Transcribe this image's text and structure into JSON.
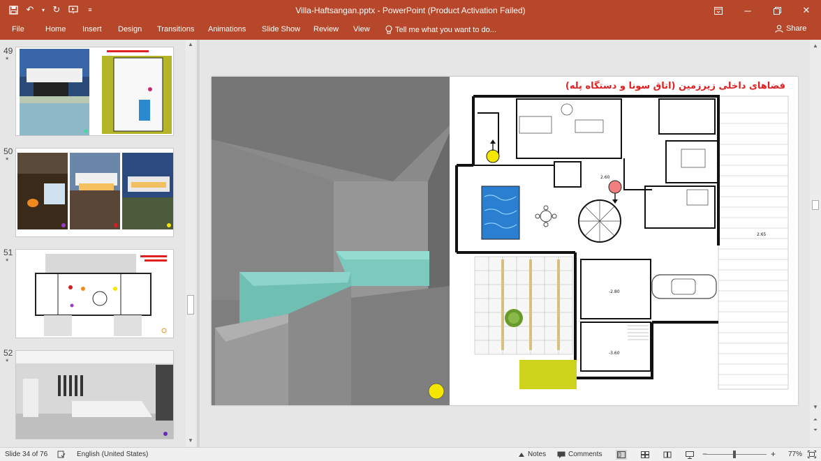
{
  "window": {
    "title": "Villa-Haftsangan.pptx - PowerPoint (Product Activation Failed)"
  },
  "ribbon": {
    "tabs": [
      "File",
      "Home",
      "Insert",
      "Design",
      "Transitions",
      "Animations",
      "Slide Show",
      "Review",
      "View"
    ],
    "tell_me": "Tell me what you want to do...",
    "share": "Share"
  },
  "thumbnails": [
    {
      "number": "49",
      "star": "*"
    },
    {
      "number": "50",
      "star": "*"
    },
    {
      "number": "51",
      "star": "*"
    },
    {
      "number": "52",
      "star": "*"
    }
  ],
  "slide": {
    "title": "فضاهای داخلی زیرزمین (اتاق سونا و دستگاه پله)",
    "plan_labels": [
      "2.60",
      "2.65",
      "-2.80",
      "-3.60"
    ]
  },
  "status": {
    "slide_counter": "Slide 34 of 76",
    "language": "English (United States)",
    "notes": "Notes",
    "comments": "Comments",
    "zoom": "77%"
  },
  "colors": {
    "accent": "#b7472a",
    "marker_yellow": "#f5e600",
    "marker_pink": "#f08080",
    "title_red": "#e02020"
  }
}
